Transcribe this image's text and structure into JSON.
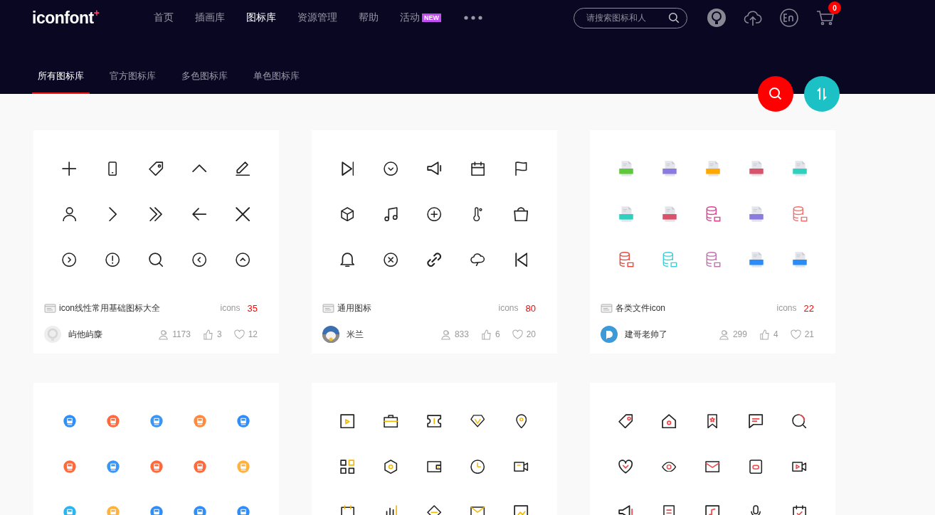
{
  "logo": {
    "text": "iconfont",
    "mark": "+"
  },
  "nav": [
    {
      "label": "首页",
      "selected": false
    },
    {
      "label": "插画库",
      "selected": false
    },
    {
      "label": "图标库",
      "selected": true
    },
    {
      "label": "资源管理",
      "selected": false
    },
    {
      "label": "帮助",
      "selected": false
    },
    {
      "label": "活动",
      "selected": false,
      "badge": "NEW"
    }
  ],
  "search": {
    "placeholder": "请搜索图标和人"
  },
  "cart": {
    "count": "0"
  },
  "tabs": [
    {
      "label": "所有图标库",
      "selected": true
    },
    {
      "label": "官方图标库",
      "selected": false
    },
    {
      "label": "多色图标库",
      "selected": false
    },
    {
      "label": "单色图标库",
      "selected": false
    }
  ],
  "cards": [
    {
      "kind": "line",
      "title": "icon线性常用基础图标大全",
      "count_label": "icons",
      "count": "35",
      "author": "屿他屿麋",
      "avatar": {
        "kind": "default"
      },
      "followers": "1173",
      "likes": "3",
      "favorites": "12"
    },
    {
      "kind": "line",
      "title": "通用图标",
      "count_label": "icons",
      "count": "80",
      "author": "米兰",
      "followers": "833",
      "likes": "6",
      "favorites": "20"
    },
    {
      "kind": "file",
      "title": "各类文件icon",
      "count_label": "icons",
      "count": "22",
      "author": "建哥老帅了",
      "avatar": {
        "kind": "logo"
      },
      "followers": "299",
      "likes": "4",
      "favorites": "21",
      "icons": [
        {
          "kind": "document",
          "color": "#5cc83a"
        },
        {
          "kind": "document",
          "color": "#8b7be0"
        },
        {
          "kind": "document",
          "color": "#ffa800"
        },
        {
          "kind": "document",
          "color": "#d9546b"
        },
        {
          "kind": "document",
          "color": "#2ed1c0"
        },
        {
          "kind": "document",
          "color": "#2ed1c0"
        },
        {
          "kind": "document",
          "color": "#d9546b"
        },
        {
          "kind": "database",
          "color": "#e0408f"
        },
        {
          "kind": "document",
          "color": "#8b7be0"
        },
        {
          "kind": "database",
          "color": "#f2706a"
        },
        {
          "kind": "database",
          "color": "#e84b3c"
        },
        {
          "kind": "database",
          "color": "#3bd0d6"
        },
        {
          "kind": "database",
          "color": "#c470b0"
        },
        {
          "kind": "document",
          "color": "#2a8cf7"
        },
        {
          "kind": "document",
          "color": "#2a8cf7"
        }
      ]
    },
    {
      "kind": "badge",
      "icons": [
        {
          "color": "#2f8ef7"
        },
        {
          "color": "#ff6a3d"
        },
        {
          "color": "#3a96f5"
        },
        {
          "color": "#ff8a3d"
        },
        {
          "color": "#2f8ef7"
        },
        {
          "color": "#ff6a3d"
        },
        {
          "color": "#3a96f5"
        },
        {
          "color": "#ff6a3d"
        },
        {
          "color": "#ff6a3d"
        },
        {
          "color": "#ffb23d"
        },
        {
          "color": "#29b6f0"
        },
        {
          "color": "#ffb23d"
        },
        {
          "color": "#2f8ef7"
        },
        {
          "color": "#2f8ef7"
        },
        {
          "color": "#2f8ef7"
        }
      ]
    },
    {
      "kind": "line"
    },
    {
      "kind": "line"
    }
  ]
}
